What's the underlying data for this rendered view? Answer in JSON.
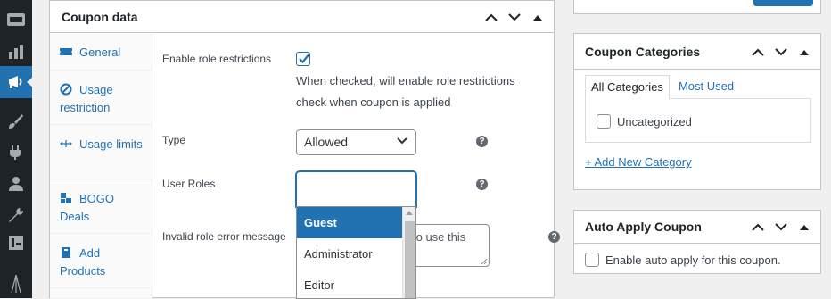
{
  "coupon_data": {
    "title": "Coupon data",
    "tabs": [
      {
        "label": "General",
        "icon": "ticket-icon"
      },
      {
        "label": "Usage restriction",
        "icon": "block-icon"
      },
      {
        "label": "Usage limits",
        "icon": "arrows-icon"
      },
      {
        "label": "BOGO Deals",
        "icon": "cubes-icon"
      },
      {
        "label": "Add Products",
        "icon": "cart-icon"
      }
    ],
    "fields": {
      "enable_role_label": "Enable role restrictions",
      "enable_role_checked": true,
      "enable_role_desc": "When checked, will enable role restrictions check when coupon is applied",
      "type_label": "Type",
      "type_value": "Allowed",
      "user_roles_label": "User Roles",
      "user_roles_value": "",
      "invalid_msg_label": "Invalid role error message",
      "invalid_msg_visible_text": "to use this"
    },
    "roles_dropdown": {
      "options": [
        "Guest",
        "Administrator",
        "Editor"
      ],
      "highlighted": "Guest"
    }
  },
  "coupon_categories": {
    "title": "Coupon Categories",
    "tabs": [
      "All Categories",
      "Most Used"
    ],
    "active_tab": "All Categories",
    "items": [
      {
        "label": "Uncategorized",
        "checked": false
      }
    ],
    "add_link": "+ Add New Category"
  },
  "auto_apply": {
    "title": "Auto Apply Coupon",
    "checkbox_label": "Enable auto apply for this coupon.",
    "checked": false
  },
  "colors": {
    "accent": "#2271b1",
    "sidebar": "#1d2327"
  }
}
